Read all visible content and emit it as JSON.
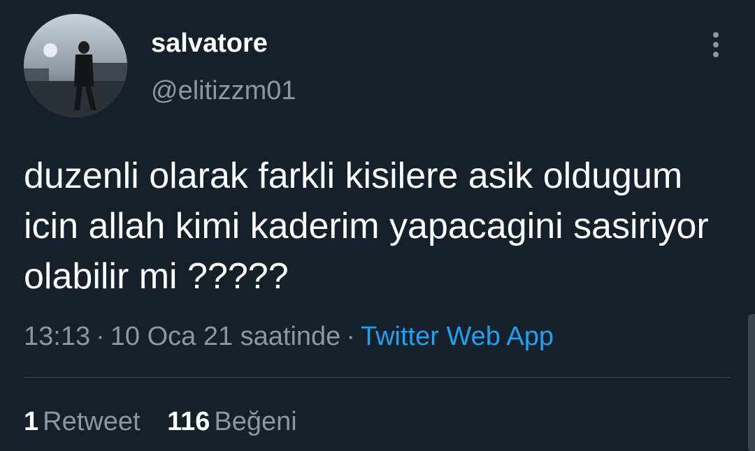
{
  "tweet": {
    "display_name": "salvatore",
    "handle": "@elitizzm01",
    "text": "duzenli olarak farkli kisilere asik oldugum icin allah kimi kaderim yapacagini sasiriyor olabilir mi ?????",
    "time": "13:13",
    "date": "10 Oca 21 saatinde",
    "separator": "·",
    "source": "Twitter Web App"
  },
  "stats": {
    "retweet_count": "1",
    "retweet_label": "Retweet",
    "like_count": "116",
    "like_label": "Beğeni"
  },
  "icons": {
    "more": "more-vertical-icon",
    "avatar": "profile-avatar"
  },
  "colors": {
    "background": "#15202b",
    "primary_text": "#ffffff",
    "secondary_text": "#8899a6",
    "link": "#1da1f2",
    "divider": "#38444d"
  }
}
